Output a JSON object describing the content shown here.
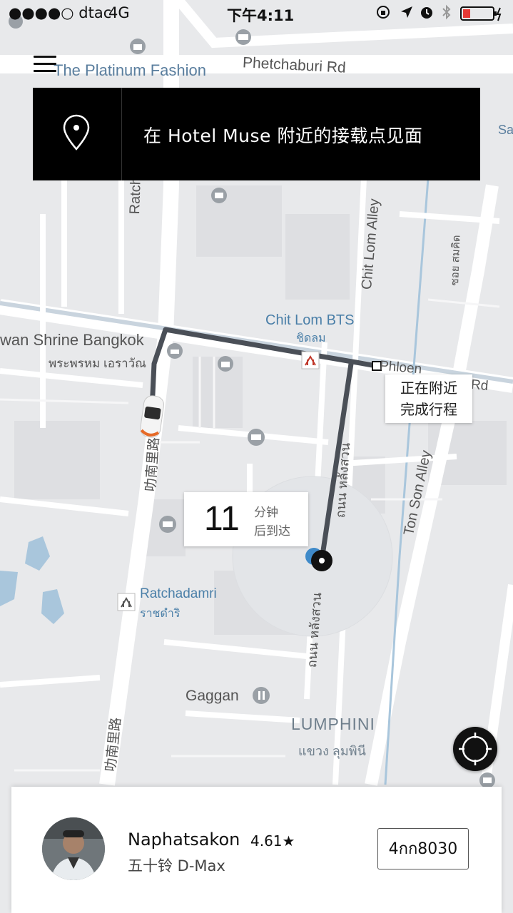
{
  "status_bar": {
    "carrier": "●●●●○ dtac",
    "network": "4G",
    "time": "下午4:11"
  },
  "banner": {
    "text": "在 Hotel Muse 附近的接载点见面"
  },
  "map": {
    "labels": {
      "platinum": "The Platinum Fashion",
      "phetchaburi": "Phetchaburi Rd",
      "ratchadamri_road": "Ratchadamri",
      "chitlom_alley": "Chit Lom Alley",
      "soi_thai": "ซอย สมคิด",
      "chitlom_bts": "Chit Lom BTS",
      "chitlom_bts_thai": "ชิดลม",
      "shrine": "wan Shrine Bangkok",
      "shrine_thai": "พระพรหม เอราวัณ",
      "phloen": "Phloen",
      "phloen_rd": "Rd",
      "ratchadamri_cn_1": "叻南里路",
      "ratchadamri_cn_2": "叻南里路",
      "lang_suan_1": "ถนน หลังสวน",
      "lang_suan_2": "ถนน หลังสวน",
      "ton_son": "Ton Son Alley",
      "ratchadamri_station": "Ratchadamri",
      "ratchadamri_station_thai": "ราชดำริ",
      "gaggan": "Gaggan",
      "lumphini": "LUMPHINI",
      "lumphini_thai": "แขวง ลุมพินี",
      "sa": "Sa"
    }
  },
  "nearby_box": {
    "line1": "正在附近",
    "line2": "完成行程"
  },
  "eta": {
    "minutes": "11",
    "unit": "分钟",
    "suffix": "后到达"
  },
  "driver": {
    "name": "Naphatsakon",
    "rating": "4.61★",
    "vehicle": "五十铃 D-Max",
    "plate": "4กก8030"
  },
  "colors": {
    "map_bg": "#e8e9eb",
    "road": "#ffffff",
    "route": "#4a4f57",
    "banner_bg": "#000000",
    "transit_label": "#4a7fa8",
    "water": "#a9c6dc"
  }
}
